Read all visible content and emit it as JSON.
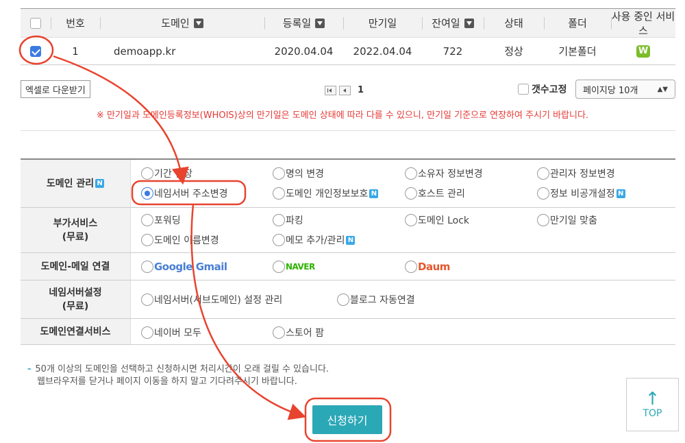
{
  "table": {
    "headers": [
      "번호",
      "도메인",
      "등록일",
      "만기일",
      "잔여일",
      "상태",
      "폴더",
      "사용 중인 서비스"
    ],
    "rows": [
      {
        "no": "1",
        "domain": "demoapp.kr",
        "registered": "2020.04.04",
        "expiry": "2022.04.04",
        "remaining": "722",
        "status": "정상",
        "folder": "기본폴더",
        "service_badge": "W"
      }
    ]
  },
  "toolbar": {
    "excel_button": "엑셀로 다운받기",
    "page": "1",
    "fix_count_label": "갯수고정",
    "per_page": "페이지당 10개",
    "notice": "※ 만기일과 도메인등록정보(WHOIS)상의 만기일은 도메인 상태에 따라 다를 수 있으니, 만기일 기준으로 연장하여 주시기 바랍니다."
  },
  "services": {
    "domain_mgmt": {
      "label": "도메인 관리",
      "options": [
        "기간 연장",
        "명의 변경",
        "소유자 정보변경",
        "관리자 정보변경",
        "네임서버 주소변경",
        "도메인 개인정보보호",
        "호스트 관리",
        "정보 비공개설정"
      ]
    },
    "addon": {
      "label_line1": "부가서비스",
      "label_line2": "(무료)",
      "options": [
        "포워딩",
        "파킹",
        "도메인 Lock",
        "만기일 맞춤",
        "도메인 이름변경",
        "메모 추가/관리"
      ]
    },
    "mail": {
      "label": "도메인-메일 연결",
      "options": [
        "Google Gmail",
        "NAVER",
        "Daum"
      ]
    },
    "ns": {
      "label_line1": "네임서버설정",
      "label_line2": "(무료)",
      "options": [
        "네임서버(서브도메인) 설정 관리",
        "블로그 자동연결"
      ]
    },
    "link": {
      "label": "도메인연결서비스",
      "options": [
        "네이버 모두",
        "스토어 팜"
      ]
    }
  },
  "footer": {
    "tip_line1": "50개 이상의 도메인을 선택하고 신청하시면 처리시간이 오래 걸릴 수 있습니다.",
    "tip_line2": "웹브라우저를 닫거나 페이지 이동을 하지 말고 기다려주시기 바랍니다.",
    "submit": "신청하기",
    "top": "TOP"
  },
  "colors": {
    "accent": "#2ba8b6",
    "annotation": "#e8432e",
    "notice": "#e53935"
  }
}
